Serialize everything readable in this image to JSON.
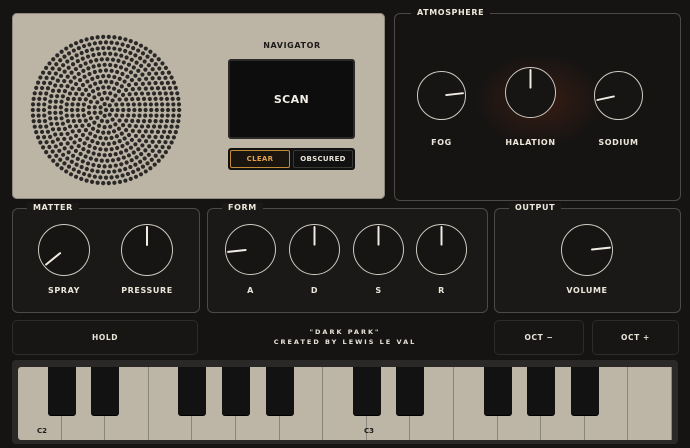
{
  "navigator": {
    "title": "NAVIGATOR",
    "screen_text": "SCAN",
    "modes": [
      {
        "label": "CLEAR",
        "active": true
      },
      {
        "label": "OBSCURED",
        "active": false
      }
    ]
  },
  "atmosphere": {
    "title": "ATMOSPHERE",
    "knobs": [
      {
        "label": "FOG",
        "value": 0.78
      },
      {
        "label": "HALATION",
        "value": 0.5
      },
      {
        "label": "SODIUM",
        "value": 0.16
      }
    ]
  },
  "matter": {
    "title": "MATTER",
    "knobs": [
      {
        "label": "SPRAY",
        "value": 0.07
      },
      {
        "label": "PRESSURE",
        "value": 0.5
      }
    ]
  },
  "form": {
    "title": "FORM",
    "knobs": [
      {
        "label": "A",
        "value": 0.18
      },
      {
        "label": "D",
        "value": 0.5
      },
      {
        "label": "S",
        "value": 0.5
      },
      {
        "label": "R",
        "value": 0.5
      }
    ]
  },
  "output": {
    "title": "OUTPUT",
    "knobs": [
      {
        "label": "VOLUME",
        "value": 0.78
      }
    ]
  },
  "controls": {
    "hold_label": "HOLD",
    "oct_down_label": "OCT −",
    "oct_up_label": "OCT +"
  },
  "credits": {
    "line1": "\"DARK PARK\"",
    "line2": "CREATED BY LEWIS LE VAL"
  },
  "keyboard": {
    "note_labels": [
      "C2",
      "C3"
    ]
  },
  "colors": {
    "accent": "#e3a24a",
    "panel_light": "#bcb5a6",
    "background": "#151413"
  }
}
